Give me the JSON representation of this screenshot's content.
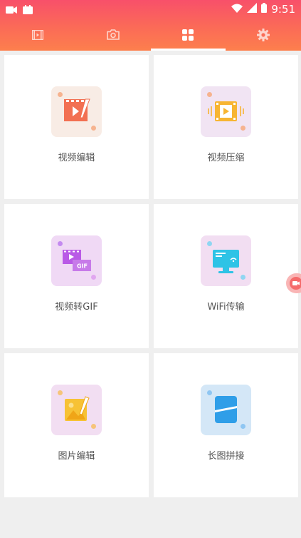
{
  "status_bar": {
    "time": "9:51",
    "left_icons": [
      "video-camera-icon",
      "calendar-icon"
    ],
    "right_icons": [
      "wifi-icon",
      "signal-icon",
      "battery-icon"
    ]
  },
  "tabs": [
    {
      "icon": "video-icon",
      "active": false
    },
    {
      "icon": "camera-icon",
      "active": false
    },
    {
      "icon": "grid-icon",
      "active": true
    },
    {
      "icon": "gear-icon",
      "active": false
    }
  ],
  "tools": [
    {
      "label": "视频编辑",
      "icon": "video-edit-icon",
      "tile_color": "#f8ece5"
    },
    {
      "label": "视频压缩",
      "icon": "video-compress-icon",
      "tile_color": "#f1e4f3"
    },
    {
      "label": "视频转GIF",
      "icon": "video-to-gif-icon",
      "tile_color": "#f0d9f5"
    },
    {
      "label": "WiFi传输",
      "icon": "wifi-transfer-icon",
      "tile_color": "#f2def2"
    },
    {
      "label": "图片编辑",
      "icon": "image-edit-icon",
      "tile_color": "#f2def2"
    },
    {
      "label": "长图拼接",
      "icon": "long-image-stitch-icon",
      "tile_color": "#d4e7f7"
    }
  ],
  "colors": {
    "header_top": "#f8506a",
    "header_bottom": "#fd7f4d",
    "page_background": "#efefef"
  }
}
